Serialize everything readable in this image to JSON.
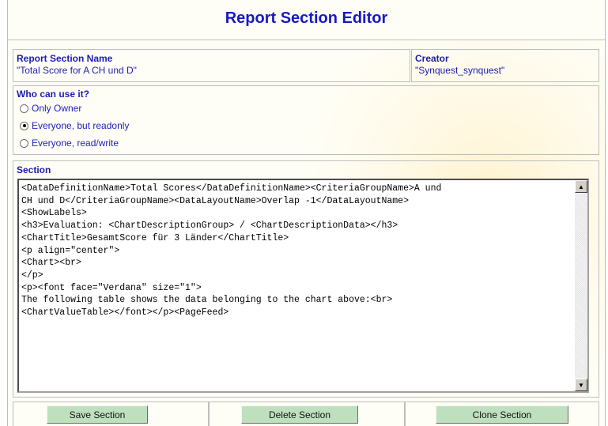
{
  "header": {
    "title": "Report Section Editor"
  },
  "fields": {
    "name_label": "Report Section Name",
    "name_value": "\"Total Score for A CH und D\"",
    "creator_label": "Creator",
    "creator_value": "\"Synquest_synquest\""
  },
  "access": {
    "label": "Who can use it?",
    "options": [
      {
        "label": "Only Owner",
        "selected": false
      },
      {
        "label": "Everyone, but readonly",
        "selected": true
      },
      {
        "label": "Everyone, read/write",
        "selected": false
      }
    ]
  },
  "section": {
    "label": "Section",
    "content": "<DataDefinitionName>Total Scores</DataDefinitionName><CriteriaGroupName>A und\nCH und D</CriteriaGroupName><DataLayoutName>Overlap -1</DataLayoutName>\n<ShowLabels>\n<h3>Evaluation: <ChartDescriptionGroup> / <ChartDescriptionData></h3>\n<ChartTitle>GesamtScore für 3 Länder</ChartTitle>\n<p align=\"center\">\n<Chart><br>\n</p>\n<p><font face=\"Verdana\" size=\"1\">\nThe following table shows the data belonging to the chart above:<br>\n<ChartValueTable></font></p><PageFeed>"
  },
  "buttons": {
    "save": "Save Section",
    "delete": "Delete Section",
    "clone": "Clone Section"
  },
  "colors": {
    "title": "#1818c8",
    "text": "#1c1cb0",
    "button_bg": "#bfe0bf",
    "panel_bg": "#fffef6"
  },
  "icons": {
    "scroll_up": "scroll-up-arrow-icon",
    "scroll_down": "scroll-down-arrow-icon"
  }
}
